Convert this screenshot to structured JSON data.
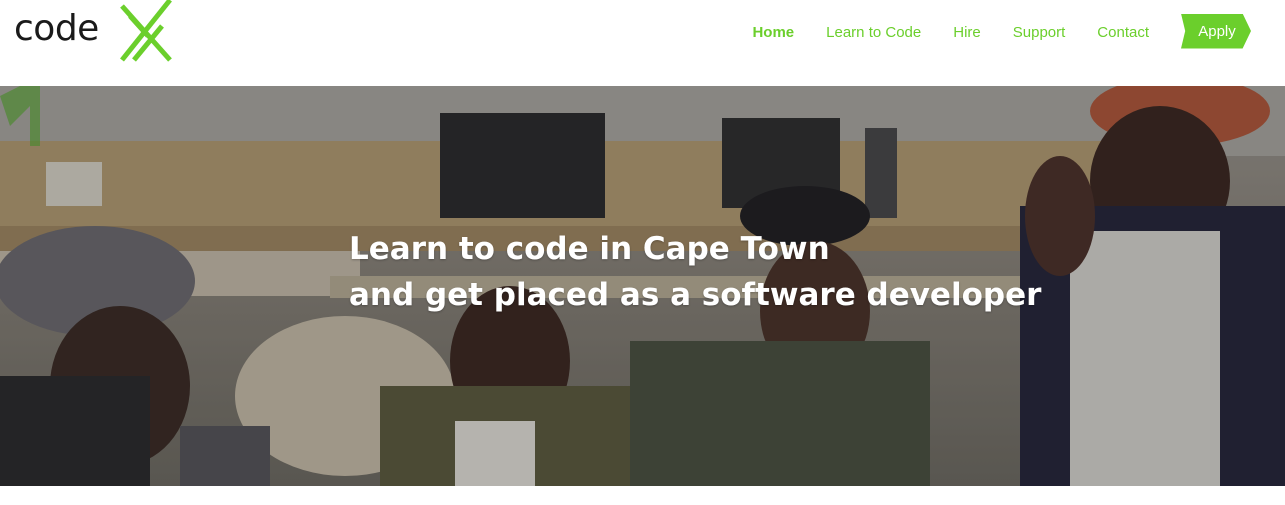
{
  "header": {
    "logo_text": "code",
    "nav": [
      {
        "label": "Home",
        "active": true
      },
      {
        "label": "Learn to Code",
        "active": false
      },
      {
        "label": "Hire",
        "active": false
      },
      {
        "label": "Support",
        "active": false
      },
      {
        "label": "Contact",
        "active": false
      }
    ],
    "apply_label": "Apply"
  },
  "hero": {
    "line1": "Learn to code in Cape Town",
    "line2": "and get placed as a software developer"
  },
  "colors": {
    "brand_green": "#6bcf2c",
    "logo_text": "#1a1a1a",
    "hero_text": "#ffffff"
  }
}
